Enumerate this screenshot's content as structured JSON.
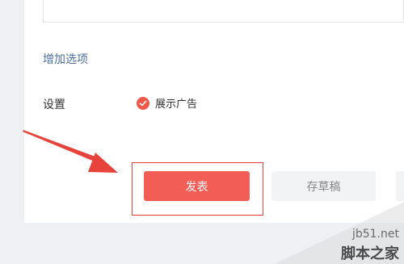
{
  "form": {
    "add_option": "增加选项",
    "settings_label": "设置",
    "show_ad_label": "展示广告",
    "show_ad_checked": true
  },
  "actions": {
    "publish_label": "发表",
    "draft_label": "存草稿"
  },
  "watermark": {
    "url": "jb51.net",
    "name": "脚本之家"
  },
  "colors": {
    "accent": "#f25d55",
    "annotation": "#e8433a"
  }
}
